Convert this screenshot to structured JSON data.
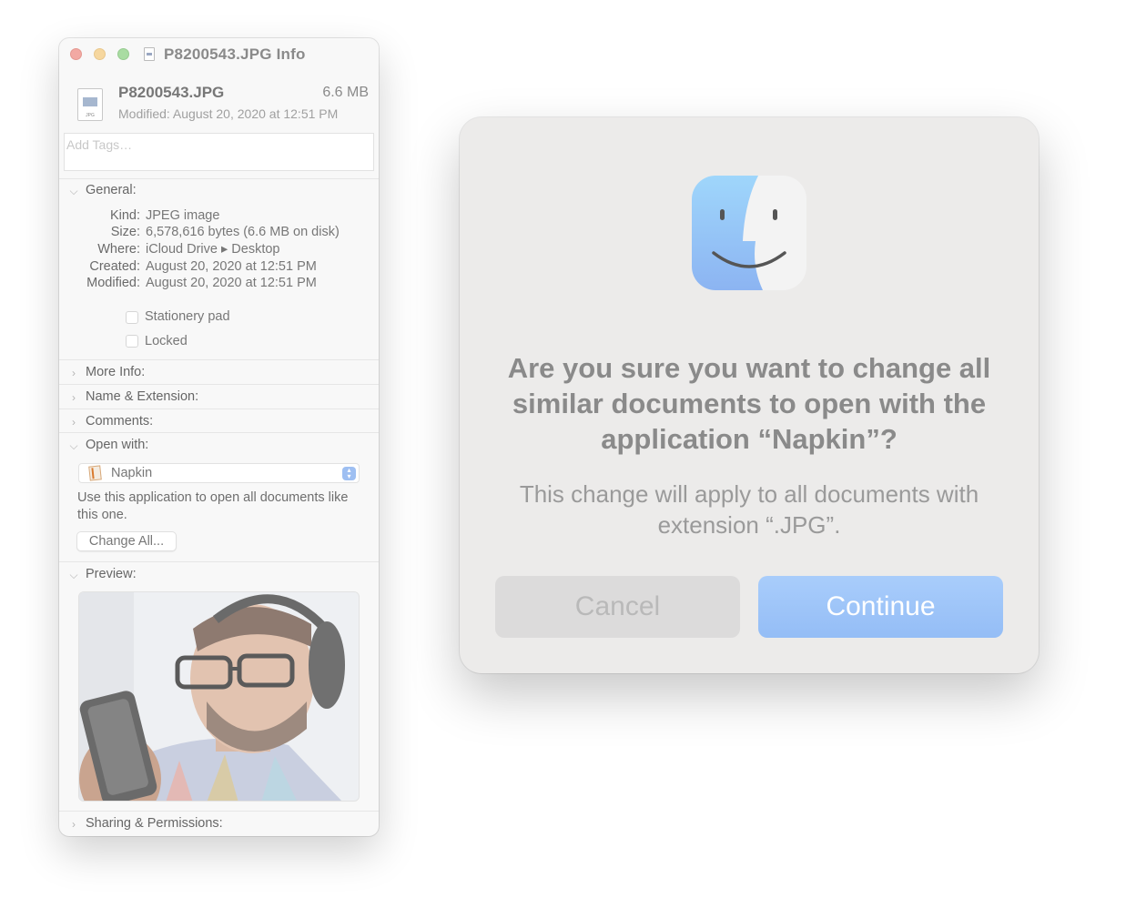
{
  "info_window": {
    "title": "P8200543.JPG Info",
    "file_icon_ext": "JPG",
    "file_name": "P8200543.JPG",
    "file_size": "6.6 MB",
    "modified_line": "Modified: August 20, 2020 at 12:51 PM",
    "tags_placeholder": "Add Tags…",
    "general": {
      "label": "General:",
      "rows": [
        {
          "key": "Kind:",
          "value": "JPEG image"
        },
        {
          "key": "Size:",
          "value": "6,578,616 bytes (6.6 MB on disk)"
        },
        {
          "key": "Where:",
          "value": "iCloud Drive ▸ Desktop"
        },
        {
          "key": "Created:",
          "value": "August 20, 2020 at 12:51 PM"
        },
        {
          "key": "Modified:",
          "value": "August 20, 2020 at 12:51 PM"
        }
      ],
      "stationery_label": "Stationery pad",
      "locked_label": "Locked"
    },
    "more_info_label": "More Info:",
    "name_extension_label": "Name & Extension:",
    "comments_label": "Comments:",
    "open_with": {
      "label": "Open with:",
      "selected_app": "Napkin",
      "help_text": "Use this application to open all documents like this one.",
      "change_all_label": "Change All..."
    },
    "preview_label": "Preview:",
    "sharing_label": "Sharing & Permissions:"
  },
  "dialog": {
    "title": "Are you sure you want to change all similar documents to open with the application “Napkin”?",
    "message": "This change will apply to all documents with extension “.JPG”.",
    "cancel_label": "Cancel",
    "continue_label": "Continue"
  },
  "colors": {
    "continue_button": "#9ec4f8",
    "cancel_button": "#dcdbdb",
    "dialog_background": "#ecebea",
    "finder_blue": "#6fb6f5"
  }
}
